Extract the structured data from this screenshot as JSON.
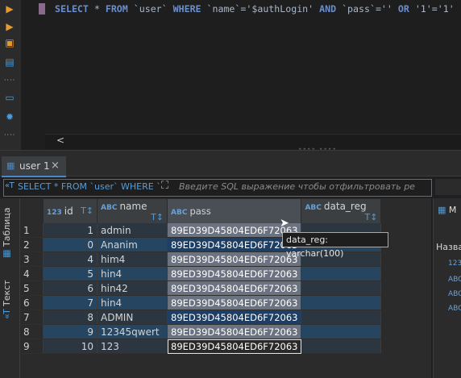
{
  "editor": {
    "sql": "SELECT * FROM `user` WHERE `name`='$authLogin' AND `pass`='' OR '1'='1'",
    "hscroll_arrow": "<"
  },
  "gutter": {
    "icons": [
      "run-triangle-icon",
      "run-triangle-plus-icon",
      "script-icon",
      "explain-icon",
      "terminal-icon",
      "gear-blue-icon"
    ]
  },
  "tab": {
    "label": "user 1",
    "close": "×"
  },
  "filter": {
    "sql": "SELECT * FROM `user` WHERE `n",
    "placeholder": "Введите SQL выражение чтобы отфильтровать ре"
  },
  "sidetabs": {
    "table": "Таблица",
    "text": "Текст"
  },
  "columns": [
    {
      "type": "123",
      "name": "id"
    },
    {
      "type": "ABC",
      "name": "name"
    },
    {
      "type": "ABC",
      "name": "pass"
    },
    {
      "type": "ABC",
      "name": "data_reg"
    }
  ],
  "rows": [
    {
      "n": "1",
      "id": "1",
      "name": "admin",
      "pass": "89ED39D45804ED6F72063",
      "data_reg": ""
    },
    {
      "n": "2",
      "id": "0",
      "name": "Ananim",
      "pass": "89ED39D45804ED6F72063",
      "data_reg": ""
    },
    {
      "n": "3",
      "id": "4",
      "name": "him4",
      "pass": "89ED39D45804ED6F72063",
      "data_reg": ""
    },
    {
      "n": "4",
      "id": "5",
      "name": "hin4",
      "pass": "89ED39D45804ED6F72063",
      "data_reg": ""
    },
    {
      "n": "5",
      "id": "6",
      "name": "hin42",
      "pass": "89ED39D45804ED6F72063",
      "data_reg": ""
    },
    {
      "n": "6",
      "id": "7",
      "name": "hin4",
      "pass": "89ED39D45804ED6F72063",
      "data_reg": ""
    },
    {
      "n": "7",
      "id": "8",
      "name": "ADMIN",
      "pass": "89ED39D45804ED6F72063",
      "data_reg": ""
    },
    {
      "n": "8",
      "id": "9",
      "name": "12345qwert",
      "pass": "89ED39D45804ED6F72063",
      "data_reg": ""
    },
    {
      "n": "9",
      "id": "10",
      "name": "123",
      "pass": "89ED39D45804ED6F72063",
      "data_reg": ""
    }
  ],
  "tooltip": "data_reg: varchar(100)",
  "right_panel": {
    "head": "M",
    "title": "Назва",
    "item_first": "123"
  }
}
